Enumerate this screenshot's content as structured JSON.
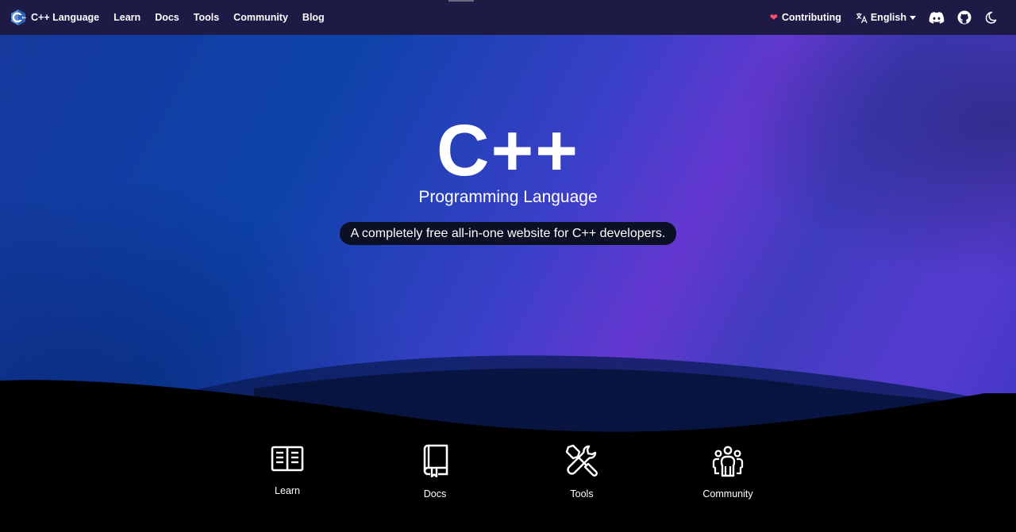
{
  "navbar": {
    "brand": "C++ Language",
    "links": [
      "Learn",
      "Docs",
      "Tools",
      "Community",
      "Blog"
    ],
    "contributing": "Contributing",
    "language": "English",
    "icons": [
      "heart-icon",
      "translate-icon",
      "discord-icon",
      "github-icon",
      "moon-icon"
    ]
  },
  "hero": {
    "title": "C++",
    "subtitle": "Programming Language",
    "tagline": "A completely free all-in-one website for C++ developers."
  },
  "features": [
    {
      "label": "Learn",
      "icon": "book-open-icon"
    },
    {
      "label": "Docs",
      "icon": "book-icon"
    },
    {
      "label": "Tools",
      "icon": "tools-icon"
    },
    {
      "label": "Community",
      "icon": "users-icon"
    }
  ],
  "colors": {
    "navbar_bg": "#1e1a46",
    "hero_blue": "#0d42a9",
    "hero_purple": "#6438d0",
    "tagline_bg": "#0c1024",
    "heart": "#ff5262",
    "footer_bg": "#000000"
  }
}
